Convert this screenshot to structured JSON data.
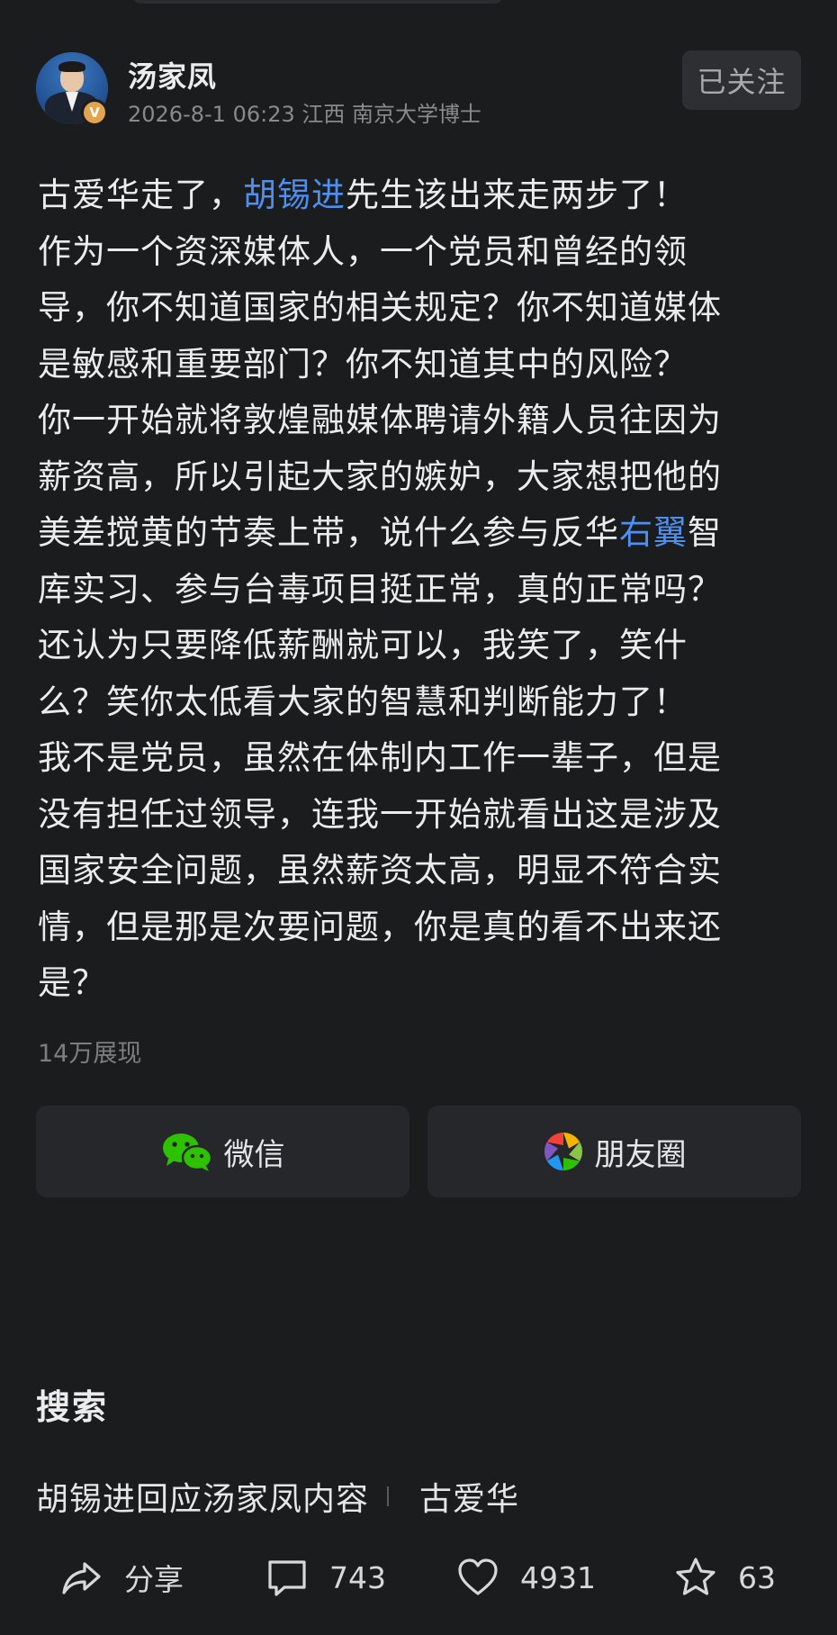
{
  "author": {
    "name": "汤家凤",
    "verify_badge": "V",
    "meta": "2026-8-1 06:23 江西 南京大学博士",
    "follow_label": "已关注"
  },
  "post": {
    "lines": [
      [
        {
          "t": "古爱华走了，"
        },
        {
          "t": "胡锡进",
          "link": true
        },
        {
          "t": "先生该出来走两步了！"
        }
      ],
      [
        {
          "t": "作为一个资深媒体人，一个党员和曾经的领"
        }
      ],
      [
        {
          "t": "导，你不知道国家的相关规定？你不知道媒体"
        }
      ],
      [
        {
          "t": "是敏感和重要部门？你不知道其中的风险？"
        }
      ],
      [
        {
          "t": "你一开始就将敦煌融媒体聘请外籍人员往因为"
        }
      ],
      [
        {
          "t": "薪资高，所以引起大家的嫉妒，大家想把他的"
        }
      ],
      [
        {
          "t": "美差搅黄的节奏上带，说什么参与反华"
        },
        {
          "t": "右翼",
          "link": true
        },
        {
          "t": "智"
        }
      ],
      [
        {
          "t": "库实习、参与台毒项目挺正常，真的正常吗？"
        }
      ],
      [
        {
          "t": "还认为只要降低薪酬就可以，我笑了，笑什"
        }
      ],
      [
        {
          "t": "么？笑你太低看大家的智慧和判断能力了！"
        }
      ],
      [
        {
          "t": "我不是党员，虽然在体制内工作一辈子，但是"
        }
      ],
      [
        {
          "t": "没有担任过领导，连我一开始就看出这是涉及"
        }
      ],
      [
        {
          "t": "国家安全问题，虽然薪资太高，明显不符合实"
        }
      ],
      [
        {
          "t": "情，但是那是次要问题，你是真的看不出来还"
        }
      ],
      [
        {
          "t": "是？"
        }
      ]
    ],
    "views": "14万展现"
  },
  "share": {
    "wechat_label": "微信",
    "moments_label": "朋友圈"
  },
  "search": {
    "title": "搜索",
    "suggestions": [
      "胡锡进回应汤家凤内容",
      "古爱华"
    ]
  },
  "actions": {
    "share_label": "分享",
    "comments": "743",
    "likes": "4931",
    "favorites": "63"
  },
  "colors": {
    "background": "#1b1c1e",
    "link": "#4e8ff0",
    "wechat_green": "#2dc100"
  }
}
